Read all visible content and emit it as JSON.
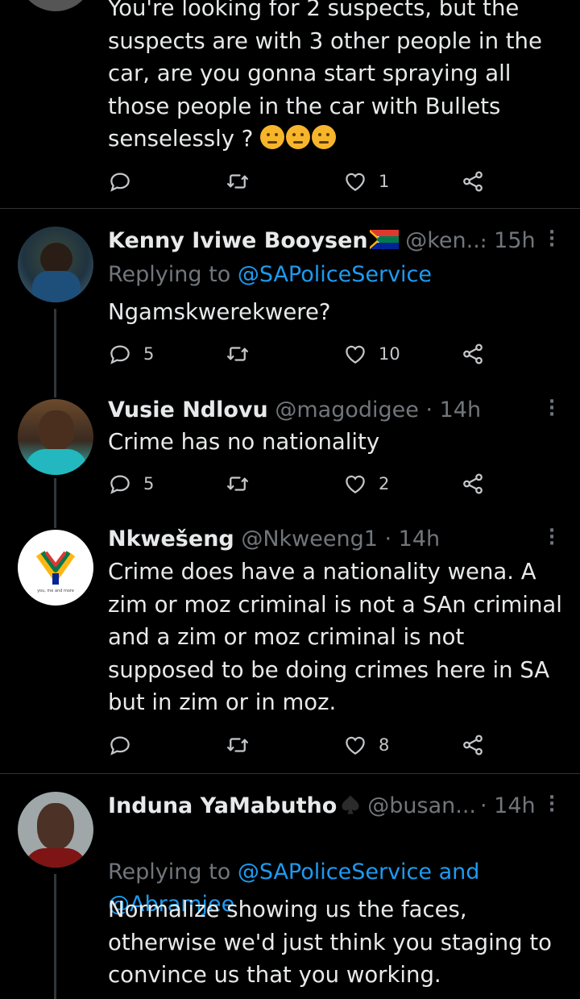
{
  "tweets": [
    {
      "text_lines": "You're looking for 2 suspects, but the\nsuspects are with 3 other people in the\ncar, are you gonna start spraying all\nthose people in the car with Bullets\nsenselessly ? ",
      "emoji": "thinking-face-emoji",
      "replies": "",
      "retweets": "",
      "likes": "1"
    },
    {
      "name": "Kenny Iviwe Booysen",
      "flag": "south-africa-flag-emoji",
      "handle": "@ken...",
      "time": "· 15h",
      "replying_prefix": "Replying to ",
      "replying_to": "@SAPoliceService",
      "text": "Ngamskwerekwere?",
      "replies": "5",
      "retweets": "",
      "likes": "10"
    },
    {
      "name": "Vusie Ndlovu",
      "handle": "@magodigee",
      "time": "· 14h",
      "text": "Crime has no nationality",
      "replies": "5",
      "retweets": "",
      "likes": "2"
    },
    {
      "name": "Nkwešeng",
      "handle": "@Nkweeng1",
      "time": "· 14h",
      "avatar_caption": "you, me and more",
      "text": "Crime does have a nationality wena. A\nzim or moz criminal is not a SAn criminal\nand a zim or moz criminal is not\nsupposed to be doing crimes here in SA\nbut in zim or in moz.",
      "replies": "",
      "retweets": "",
      "likes": "8"
    },
    {
      "name": "Induna YaMabutho",
      "badge": "spade-icon",
      "handle": "@busan...",
      "time": "· 14h",
      "replying_prefix": "Replying to ",
      "replying_to": "@SAPoliceService and\n@Abramjee",
      "text": "Normalize showing us the faces,\notherwise we'd just think you staging to\nconvince us that you working."
    }
  ],
  "colors": {
    "background": "#000000",
    "text": "#e7e9ea",
    "muted": "#71767b",
    "link": "#1d9bf0",
    "divider": "#2f3336"
  }
}
